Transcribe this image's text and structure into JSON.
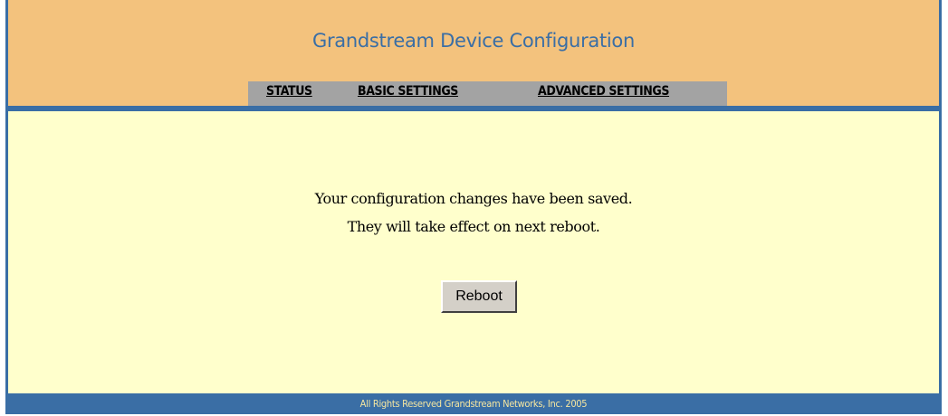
{
  "header": {
    "title": "Grandstream Device Configuration",
    "nav": {
      "status": "STATUS",
      "basic_settings": "BASIC SETTINGS",
      "advanced_settings": "ADVANCED SETTINGS"
    }
  },
  "main": {
    "message_line1": "Your configuration changes have been saved.",
    "message_line2": "They will take effect on next reboot.",
    "reboot_label": "Reboot"
  },
  "footer": {
    "copyright": "All Rights Reserved Grandstream Networks, Inc. 2005"
  },
  "colors": {
    "header_bg": "#f3c27d",
    "body_bg": "#ffffcc",
    "accent_blue": "#3a6ea5",
    "nav_bg": "#a3a3a3"
  }
}
